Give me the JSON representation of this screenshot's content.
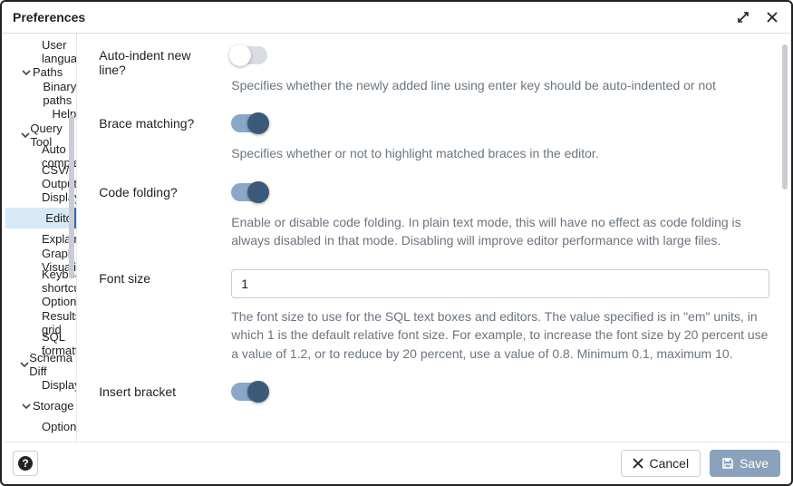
{
  "window": {
    "title": "Preferences"
  },
  "sidebar": {
    "items": [
      {
        "label": "User language",
        "level": 2,
        "caret": ""
      },
      {
        "label": "Paths",
        "level": 1,
        "caret": "down"
      },
      {
        "label": "Binary paths",
        "level": 2,
        "caret": ""
      },
      {
        "label": "Help",
        "level": 2,
        "caret": ""
      },
      {
        "label": "Query Tool",
        "level": 1,
        "caret": "down"
      },
      {
        "label": "Auto completion",
        "level": 2,
        "caret": ""
      },
      {
        "label": "CSV/TXT Output",
        "level": 2,
        "caret": ""
      },
      {
        "label": "Display",
        "level": 2,
        "caret": ""
      },
      {
        "label": "Editor",
        "level": 2,
        "caret": "",
        "selected": true
      },
      {
        "label": "Explain",
        "level": 2,
        "caret": ""
      },
      {
        "label": "Graph Visualiser",
        "level": 2,
        "caret": ""
      },
      {
        "label": "Keyboard shortcuts",
        "level": 2,
        "caret": ""
      },
      {
        "label": "Options",
        "level": 2,
        "caret": ""
      },
      {
        "label": "Results grid",
        "level": 2,
        "caret": ""
      },
      {
        "label": "SQL formatting",
        "level": 2,
        "caret": ""
      },
      {
        "label": "Schema Diff",
        "level": 1,
        "caret": "down"
      },
      {
        "label": "Display",
        "level": 2,
        "caret": ""
      },
      {
        "label": "Storage",
        "level": 1,
        "caret": "down"
      },
      {
        "label": "Options",
        "level": 2,
        "caret": ""
      }
    ]
  },
  "settings": {
    "auto_indent": {
      "label": "Auto-indent new line?",
      "value": false,
      "desc": "Specifies whether the newly added line using enter key should be auto-indented or not"
    },
    "brace_matching": {
      "label": "Brace matching?",
      "value": true,
      "desc": "Specifies whether or not to highlight matched braces in the editor."
    },
    "code_folding": {
      "label": "Code folding?",
      "value": true,
      "desc": "Enable or disable code folding. In plain text mode, this will have no effect as code folding is always disabled in that mode. Disabling will improve editor performance with large files."
    },
    "font_size": {
      "label": "Font size",
      "value": "1",
      "desc": "The font size to use for the SQL text boxes and editors. The value specified is in \"em\" units, in which 1 is the default relative font size. For example, to increase the font size by 20 percent use a value of 1.2, or to reduce by 20 percent, use a value of 0.8. Minimum 0.1, maximum 10."
    },
    "insert_bracket": {
      "label": "Insert bracket",
      "value": true
    }
  },
  "footer": {
    "cancel_label": "Cancel",
    "save_label": "Save"
  }
}
